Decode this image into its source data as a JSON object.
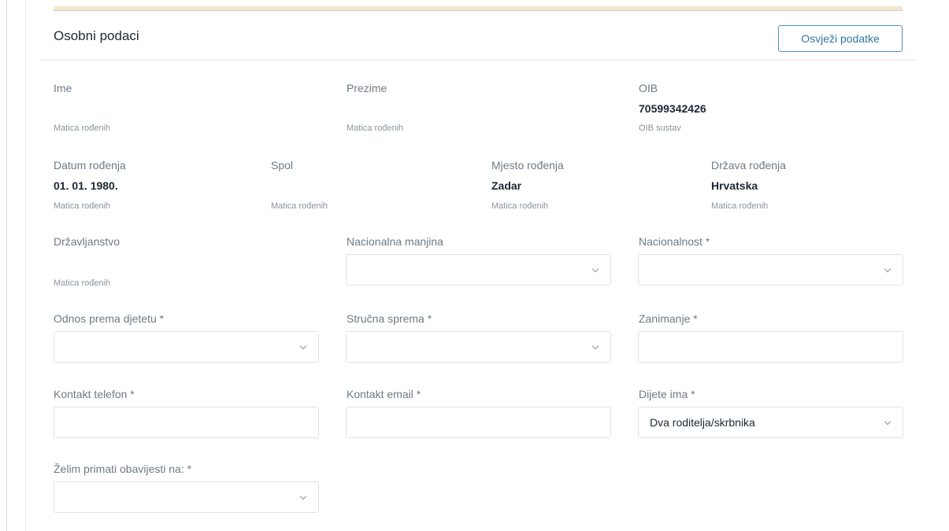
{
  "header": {
    "title": "Osobni podaci",
    "refresh_label": "Osvježi podatke"
  },
  "fields": {
    "ime": {
      "label": "Ime",
      "source": "Matica rođenih"
    },
    "prezime": {
      "label": "Prezime",
      "source": "Matica rođenih"
    },
    "oib": {
      "label": "OIB",
      "value": "70599342426",
      "source": "OIB sustav"
    },
    "datum_rodenja": {
      "label": "Datum rođenja",
      "value": "01. 01. 1980.",
      "source": "Matica rođenih"
    },
    "spol": {
      "label": "Spol",
      "source": "Matica rođenih"
    },
    "mjesto_rodenja": {
      "label": "Mjesto rođenja",
      "value": "Zadar",
      "source": "Matica rođenih"
    },
    "drzava_rodenja": {
      "label": "Država rođenja",
      "value": "Hrvatska",
      "source": "Matica rođenih"
    },
    "drzavljanstvo": {
      "label": "Državljanstvo",
      "source": "Matica rođenih"
    },
    "nacionalna_manjina": {
      "label": "Nacionalna manjina",
      "value": ""
    },
    "nacionalnost": {
      "label": "Nacionalnost *",
      "value": ""
    },
    "odnos_prema_djetetu": {
      "label": "Odnos prema djetetu *",
      "value": ""
    },
    "strucna_sprema": {
      "label": "Stručna sprema *",
      "value": ""
    },
    "zanimanje": {
      "label": "Zanimanje *",
      "value": ""
    },
    "kontakt_telefon": {
      "label": "Kontakt telefon *",
      "value": ""
    },
    "kontakt_email": {
      "label": "Kontakt email *",
      "value": ""
    },
    "dijete_ima": {
      "label": "Dijete ima *",
      "value": "Dva roditelja/skrbnika"
    },
    "obavijesti": {
      "label": "Želim primati obavijesti na: *",
      "value": ""
    }
  }
}
